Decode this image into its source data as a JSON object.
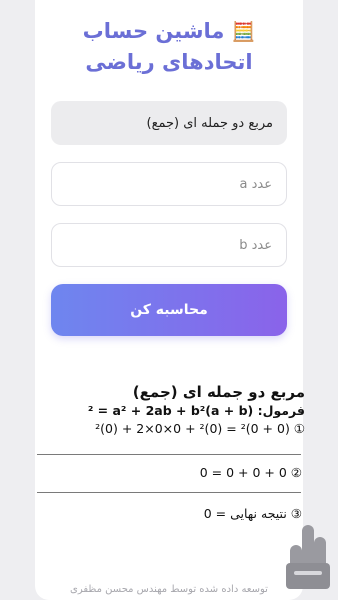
{
  "app": {
    "title": "ماشین حساب اتحادهای ریاضی",
    "title_icon": "🧮"
  },
  "form": {
    "select_value": "مربع دو جمله ای (جمع)",
    "input_a_placeholder": "عدد a",
    "input_b_placeholder": "عدد b",
    "calc_button": "محاسبه کن"
  },
  "result": {
    "title": "مربع دو جمله ای (جمع)",
    "formula": "فرمول: (a + b)² = a² + 2ab + b²",
    "step1": "① (0 + 0)² = (0)² + 0×0×2 + (0)²",
    "step2": "② 0 + 0 + 0 = 0",
    "step3": "③ نتیجه نهایی = 0"
  },
  "footer": {
    "text": "توسعه داده شده توسط مهندس محسن مظفری"
  },
  "colors": {
    "accent_start": "#6e86ef",
    "accent_end": "#8a63ea",
    "title_color": "#6b6fd6"
  },
  "icons": {
    "title": "abacus-icon",
    "watermark": "app-logo-icon"
  }
}
